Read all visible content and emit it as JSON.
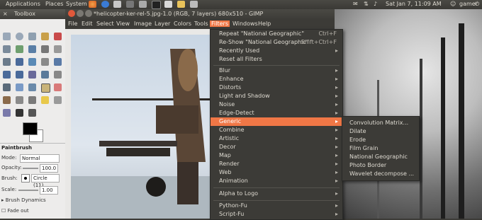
{
  "panel": {
    "menus": [
      "Applications",
      "Places",
      "System"
    ],
    "datetime": "Sat Jan  7, 11:09 AM",
    "user": "gamer"
  },
  "toolbox": {
    "title": "Toolbox",
    "tool_options_title": "Paintbrush",
    "mode_label": "Mode:",
    "mode_value": "Normal",
    "opacity_label": "Opacity:",
    "opacity_value": "100.0",
    "brush_label": "Brush:",
    "brush_value": "Circle (11)",
    "scale_label": "Scale:",
    "scale_value": "1.00",
    "brush_dynamics": "Brush Dynamics",
    "fade_out": "Fade out"
  },
  "gimp": {
    "title": "*helicopter-ker-rel-5.jpg-1.0 (RGB, 7 layers) 680x510 - GIMP",
    "menubar": [
      "File",
      "Edit",
      "Select",
      "View",
      "Image",
      "Layer",
      "Colors",
      "Tools",
      "Filters",
      "Windows",
      "Help"
    ]
  },
  "filters_menu": {
    "top_items": [
      {
        "label": "Repeat \"National Geographic\"",
        "shortcut": "Ctrl+F"
      },
      {
        "label": "Re-Show \"National Geographic\"",
        "shortcut": "Shift+Ctrl+F"
      },
      {
        "label": "Recently Used",
        "shortcut": ""
      },
      {
        "label": "Reset all Filters",
        "shortcut": ""
      }
    ],
    "items": [
      "Blur",
      "Enhance",
      "Distorts",
      "Light and Shadow",
      "Noise",
      "Edge-Detect",
      "Generic",
      "Combine",
      "Artistic",
      "Decor",
      "Map",
      "Render",
      "Web",
      "Animation"
    ],
    "bottom_items": [
      "Alpha to Logo",
      "Python-Fu",
      "Script-Fu"
    ],
    "highlighted": "Generic"
  },
  "generic_menu": {
    "items": [
      "Convolution Matrix...",
      "Dilate",
      "Erode",
      "Film Grain",
      "National Geographic",
      "Photo Border",
      "Wavelet decompose ..."
    ]
  },
  "colors": {
    "highlight": "#f07746",
    "menu_bg": "#3c3b37"
  }
}
